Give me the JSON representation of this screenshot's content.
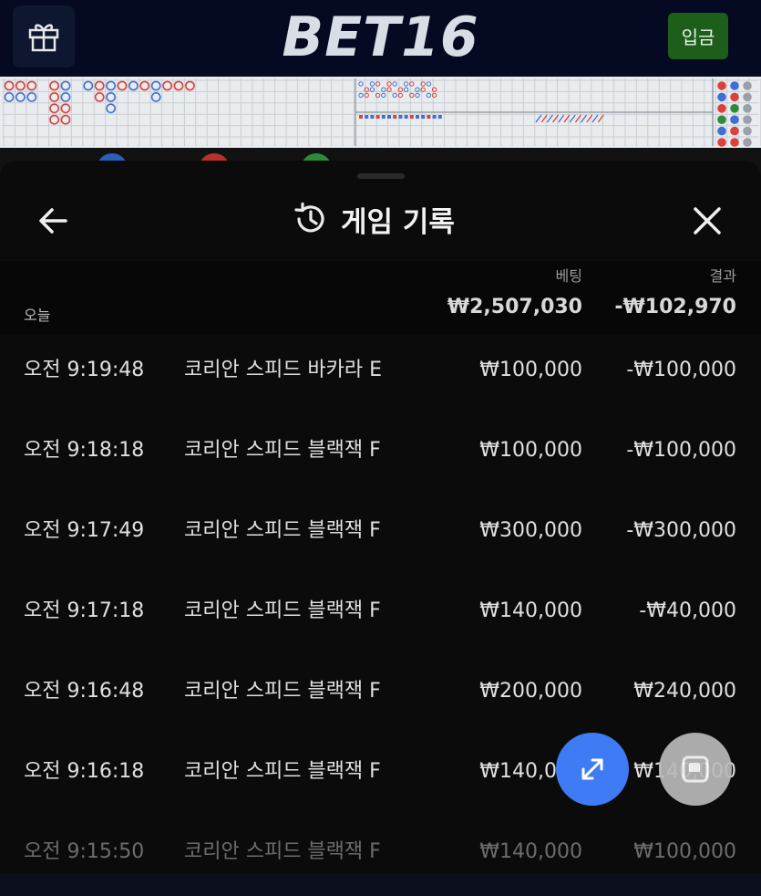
{
  "header": {
    "logo": "BET16",
    "deposit_label": "입금"
  },
  "history": {
    "title": "게임 기록",
    "col_bet": "베팅",
    "col_result": "결과",
    "today_label": "오늘",
    "today_bet": "₩2,507,030",
    "today_result": "-₩102,970",
    "rows": [
      {
        "time": "오전 9:19:48",
        "game": "코리안 스피드 바카라 E",
        "bet": "₩100,000",
        "result": "-₩100,000"
      },
      {
        "time": "오전 9:18:18",
        "game": "코리안 스피드 블랙잭 F",
        "bet": "₩100,000",
        "result": "-₩100,000"
      },
      {
        "time": "오전 9:17:49",
        "game": "코리안 스피드 블랙잭 F",
        "bet": "₩300,000",
        "result": "-₩300,000"
      },
      {
        "time": "오전 9:17:18",
        "game": "코리안 스피드 블랙잭 F",
        "bet": "₩140,000",
        "result": "-₩40,000"
      },
      {
        "time": "오전 9:16:48",
        "game": "코리안 스피드 블랙잭 F",
        "bet": "₩200,000",
        "result": "₩240,000"
      },
      {
        "time": "오전 9:16:18",
        "game": "코리안 스피드 블랙잭 F",
        "bet": "₩140,000",
        "result": "₩140,000"
      },
      {
        "time": "오전 9:15:50",
        "game": "코리안 스피드 블랙잭 F",
        "bet": "₩140,000",
        "result": "₩100,000"
      }
    ]
  },
  "colors": {
    "accent_blue": "#3f7bf4",
    "deposit_green": "#1d5e1a"
  },
  "icons": [
    "gift-icon",
    "history-icon",
    "arrow-left-icon",
    "close-icon",
    "expand-icon",
    "picture-in-picture-icon"
  ]
}
